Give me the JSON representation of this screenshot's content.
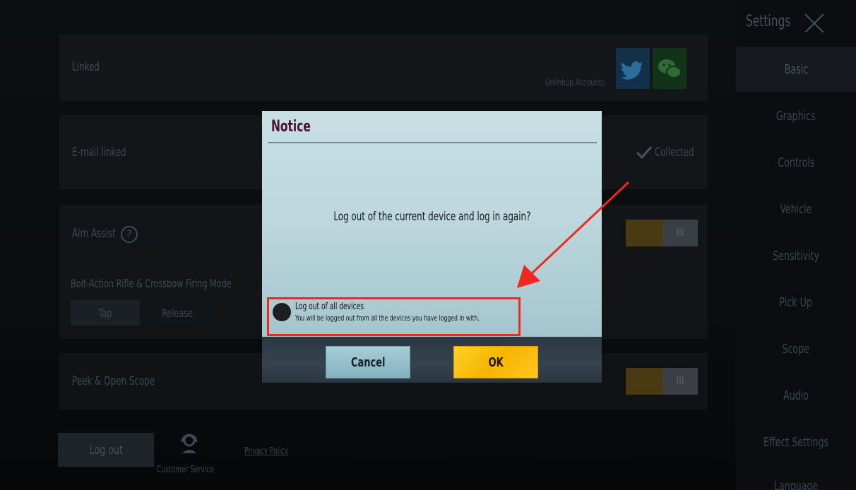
{
  "background": {
    "rows": {
      "linked": "Linked",
      "unlink_accounts": "Unlinkup Accounts",
      "email_linked": "E-mail linked",
      "collected": "Collected",
      "aim_assist": "Aim Assist",
      "aim_assist_help": "?",
      "firing_mode": "Bolt-Action Rifle & Crossbow Firing Mode",
      "tap": "Tap",
      "release": "Release",
      "peek_open_scope": "Peek & Open Scope",
      "toggle_off_label": "III"
    },
    "footer": {
      "log_out": "Log out",
      "customer_service": "Customer Service",
      "privacy_policy": "Privacy Policy"
    }
  },
  "sidebar": {
    "title": "Settings",
    "items": [
      {
        "label": "Basic",
        "active": true
      },
      {
        "label": "Graphics"
      },
      {
        "label": "Controls"
      },
      {
        "label": "Vehicle"
      },
      {
        "label": "Sensitivity"
      },
      {
        "label": "Pick Up"
      },
      {
        "label": "Scope"
      },
      {
        "label": "Audio"
      },
      {
        "label": "Effect Settings"
      },
      {
        "label": "Language"
      }
    ]
  },
  "dialog": {
    "title": "Notice",
    "question": "Log out of the current device and log in again?",
    "option_label": "Log out of all devices",
    "option_desc": "You will be logged out from all the devices you have logged in with.",
    "cancel": "Cancel",
    "ok": "OK"
  },
  "colors": {
    "highlight": "#f2281e",
    "ok_button": "#f6b400",
    "dialog_bg": "#bcd7dd"
  }
}
